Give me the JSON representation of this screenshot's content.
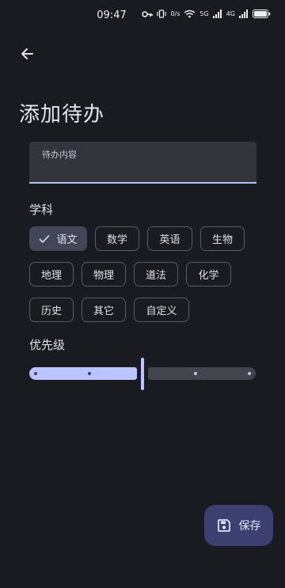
{
  "status_bar": {
    "time": "09:47",
    "network_speed": "0/s",
    "signal_labels": [
      "5G",
      "4G"
    ]
  },
  "header": {
    "title": "添加待办",
    "back_icon": "arrow-left-icon"
  },
  "todo_field": {
    "label": "待办内容",
    "value": ""
  },
  "subject": {
    "label": "学科",
    "chips": [
      {
        "label": "语文",
        "selected": true
      },
      {
        "label": "数学",
        "selected": false
      },
      {
        "label": "英语",
        "selected": false
      },
      {
        "label": "生物",
        "selected": false
      },
      {
        "label": "地理",
        "selected": false
      },
      {
        "label": "物理",
        "selected": false
      },
      {
        "label": "道法",
        "selected": false
      },
      {
        "label": "化学",
        "selected": false
      },
      {
        "label": "历史",
        "selected": false
      },
      {
        "label": "其它",
        "selected": false
      },
      {
        "label": "自定义",
        "selected": false
      }
    ]
  },
  "priority": {
    "label": "优先级",
    "steps": 5,
    "value_fraction": 0.5
  },
  "fab": {
    "label": "保存",
    "icon": "save-icon"
  },
  "colors": {
    "background": "#1a1a21",
    "accent": "#bcc4ff",
    "chip_selected": "#434659",
    "fab": "#3b4071"
  }
}
